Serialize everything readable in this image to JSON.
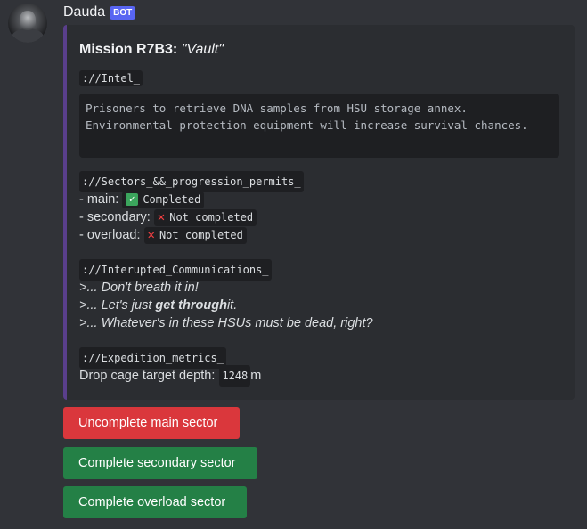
{
  "message": {
    "author": "Dauda",
    "bot_tag": "BOT"
  },
  "embed": {
    "title_prefix": "Mission R7B3: ",
    "title_name": "\"Vault\"",
    "intel_label": "://Intel_",
    "intel_text": "Prisoners to retrieve DNA samples from HSU storage annex. Environmental protection equipment will increase survival chances.",
    "sectors_label": "://Sectors_&&_progression_permits_",
    "sectors": [
      {
        "name": "- main:",
        "status": "Completed",
        "done": true
      },
      {
        "name": "- secondary:",
        "status": "Not completed",
        "done": false
      },
      {
        "name": "- overload:",
        "status": "Not completed",
        "done": false
      }
    ],
    "comms_label": "://Interupted_Communications_",
    "comms": [
      {
        "pre": ">... Don't breath it in!",
        "bold": "",
        "post": ""
      },
      {
        "pre": ">... Let's just ",
        "bold": "get through",
        "post": " it."
      },
      {
        "pre": ">... Whatever's in these HSUs must be dead, right?",
        "bold": "",
        "post": ""
      }
    ],
    "metrics_label": "://Expedition_metrics_",
    "depth_label": "Drop cage target depth:",
    "depth_value": "1248",
    "depth_unit": "m"
  },
  "buttons": {
    "uncomplete_main": "Uncomplete main sector",
    "complete_secondary": "Complete secondary sector",
    "complete_overload": "Complete overload sector"
  },
  "colors": {
    "accent_bar": "#5a3f8c",
    "danger": "#da373c",
    "success": "#248046",
    "bot_tag": "#5865f2"
  }
}
